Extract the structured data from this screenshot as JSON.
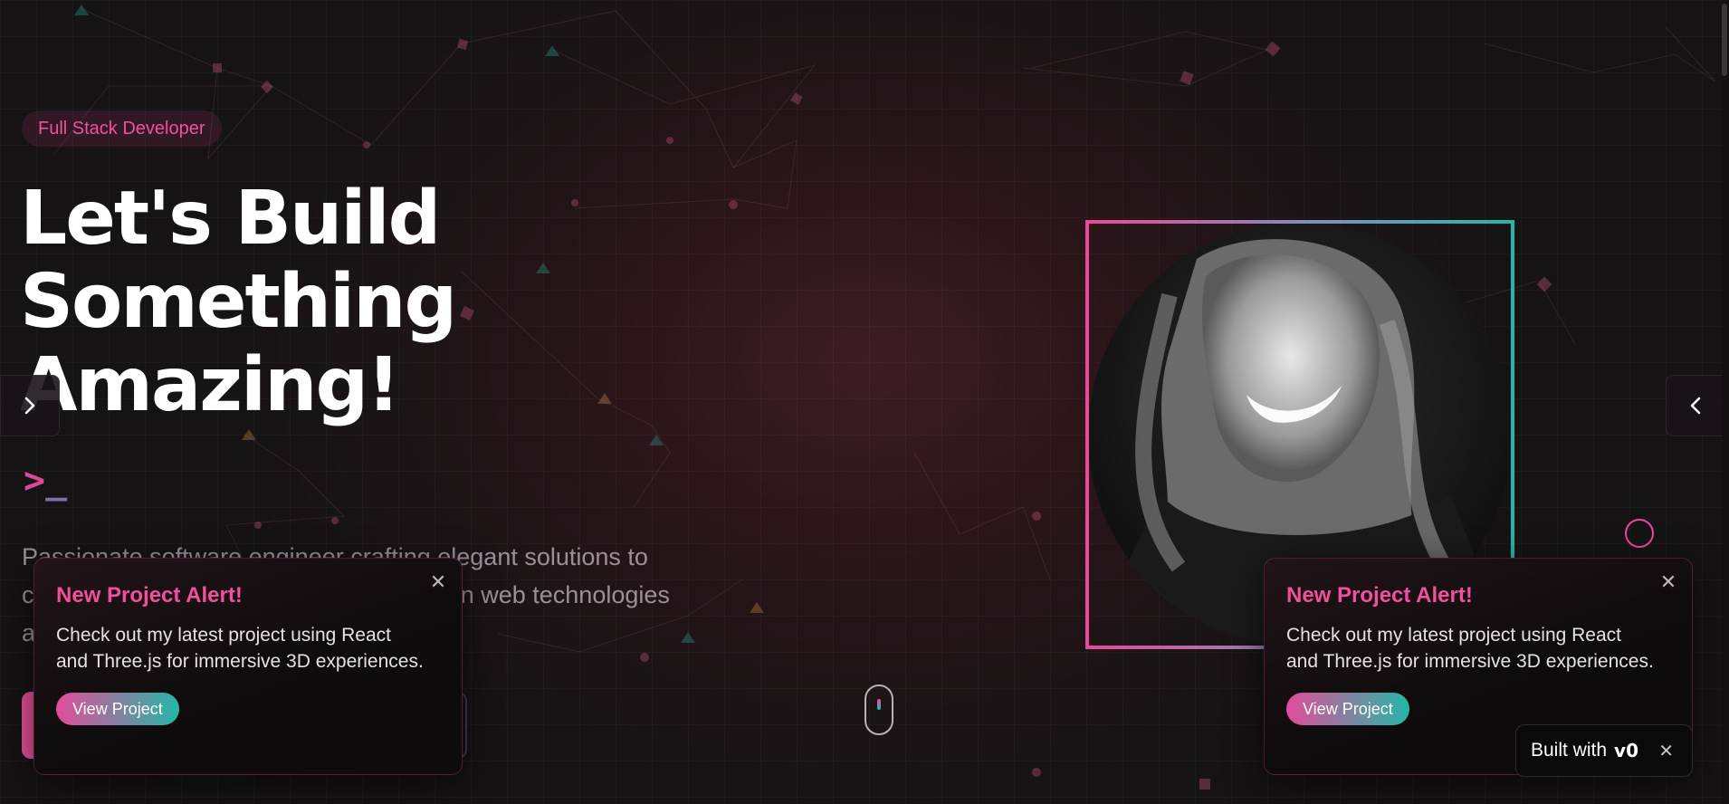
{
  "hero": {
    "badge": "Full Stack Developer",
    "headline": [
      "Let's Build",
      "Something",
      "Amazing!"
    ],
    "prompt_symbol": ">",
    "prompt_cursor": "_",
    "bio": "Passionate software engineer crafting elegant solutions to complex problems. Specialized in modern web technologies and 3D experiences."
  },
  "carousel": {
    "prev_icon": "chevron-right-icon",
    "next_icon": "chevron-left-icon"
  },
  "toasts": [
    {
      "title": "New Project Alert!",
      "body": "Check out my latest project using React and Three.js for immersive 3D experiences.",
      "button": "View Project"
    },
    {
      "title": "New Project Alert!",
      "body": "Check out my latest project using React and Three.js for immersive 3D experiences.",
      "button": "View Project"
    }
  ],
  "v0_badge": {
    "label": "Built with",
    "logo": "v0"
  },
  "colors": {
    "accent_pink": "#ec4899",
    "accent_teal": "#22b8a8",
    "background": "#1b1416"
  }
}
